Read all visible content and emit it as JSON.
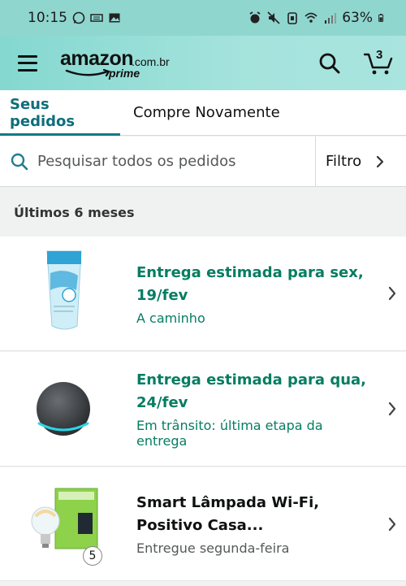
{
  "status_bar": {
    "time": "10:15",
    "battery": "63%"
  },
  "header": {
    "logo_word": "amazon",
    "logo_tld": ".com.br",
    "logo_prime": "prime",
    "cart_count": "3"
  },
  "tabs": [
    {
      "label": "Seus pedidos",
      "active": true
    },
    {
      "label": "Compre Novamente",
      "active": false
    }
  ],
  "search": {
    "placeholder": "Pesquisar todos os pedidos",
    "filter_label": "Filtro"
  },
  "section_title": "Últimos 6 meses",
  "orders": [
    {
      "title": "Entrega estimada para sex, 19/fev",
      "status": "A caminho",
      "product_icon": "sunscreen-tube-icon"
    },
    {
      "title": "Entrega estimada para qua, 24/fev",
      "status": "Em trânsito: última etapa da entrega",
      "product_icon": "smart-speaker-icon"
    },
    {
      "title": "Smart Lâmpada Wi-Fi, Positivo Casa...",
      "status": "Entregue segunda-feira",
      "product_icon": "smart-bulb-icon",
      "quantity": "5"
    }
  ],
  "colors": {
    "accent_teal": "#0e6e7b",
    "status_green": "#067d62",
    "header_bg": "#a5e3dd"
  }
}
